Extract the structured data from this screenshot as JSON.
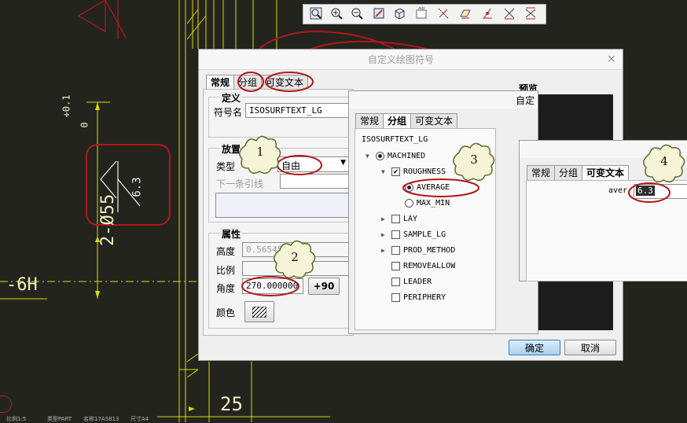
{
  "toolbar": {
    "icons": [
      "zoom-refit-icon",
      "zoom-in-icon",
      "zoom-out-icon",
      "repaint-icon",
      "view-orientation-icon",
      "saved-views-icon",
      "datum-axes-icon",
      "datum-planes-icon",
      "datum-points-icon",
      "datum-csys-icon",
      "spin-center-icon"
    ]
  },
  "cad": {
    "dim_text": "2-Ø55",
    "dim_tol_upper": "+0.1",
    "dim_tol_lower": "0",
    "roughness_value": "6.3",
    "thread_label": "6H",
    "dim_25": "25",
    "status_items": [
      "比例1:5",
      "类型PART",
      "名称17A5813",
      "尺寸A4"
    ]
  },
  "dialog_main": {
    "title": "自定义绘图符号",
    "close": "×",
    "tabs": [
      "常规",
      "分组",
      "可变文本"
    ],
    "definition": {
      "title": "定义",
      "symbol_name_label": "符号名",
      "symbol_name_value": "ISOSURFTEXT_LG"
    },
    "placement": {
      "title": "放置",
      "type_label": "类型",
      "type_value": "自由",
      "next_leader_label": "下一条引线"
    },
    "properties": {
      "title": "属性",
      "height_label": "高度",
      "height_value": "0.565450",
      "scale_label": "比例",
      "angle_label": "角度",
      "angle_value": "270.000000",
      "plus90": "+90",
      "color_label": "颜色"
    },
    "preview_label": "预览",
    "ok": "确定",
    "cancel": "取消"
  },
  "dialog_group": {
    "title": "自定",
    "tabs": [
      "常规",
      "分组",
      "可变文本"
    ],
    "symbol_name": "ISOSURFTEXT_LG",
    "tree": [
      {
        "label": "MACHINED",
        "control": "radio",
        "checked": true,
        "expand": "down"
      },
      {
        "label": "ROUGHNESS",
        "control": "check",
        "checked": true,
        "expand": "down"
      },
      {
        "label": "AVERAGE",
        "control": "radio",
        "checked": true,
        "expand": ""
      },
      {
        "label": "MAX_MIN",
        "control": "radio",
        "checked": false,
        "expand": ""
      },
      {
        "label": "LAY",
        "control": "check",
        "checked": false,
        "expand": "right"
      },
      {
        "label": "SAMPLE_LG",
        "control": "check",
        "checked": false,
        "expand": "right"
      },
      {
        "label": "PROD_METHOD",
        "control": "check",
        "checked": false,
        "expand": "right"
      },
      {
        "label": "REMOVEALLOW",
        "control": "check",
        "checked": false,
        "expand": ""
      },
      {
        "label": "LEADER",
        "control": "check",
        "checked": false,
        "expand": ""
      },
      {
        "label": "PERIPHERY",
        "control": "check",
        "checked": false,
        "expand": ""
      }
    ]
  },
  "dialog_vartext": {
    "tabs": [
      "常规",
      "分组",
      "可变文本"
    ],
    "var_label": "aver",
    "var_value": "6.3"
  },
  "callouts": [
    "1",
    "2",
    "3",
    "4"
  ],
  "colors": {
    "annotation": "#b01818",
    "cad_line": "#e8e800",
    "cad_text": "#f4f4b0",
    "cad_bg": "#24241f"
  }
}
